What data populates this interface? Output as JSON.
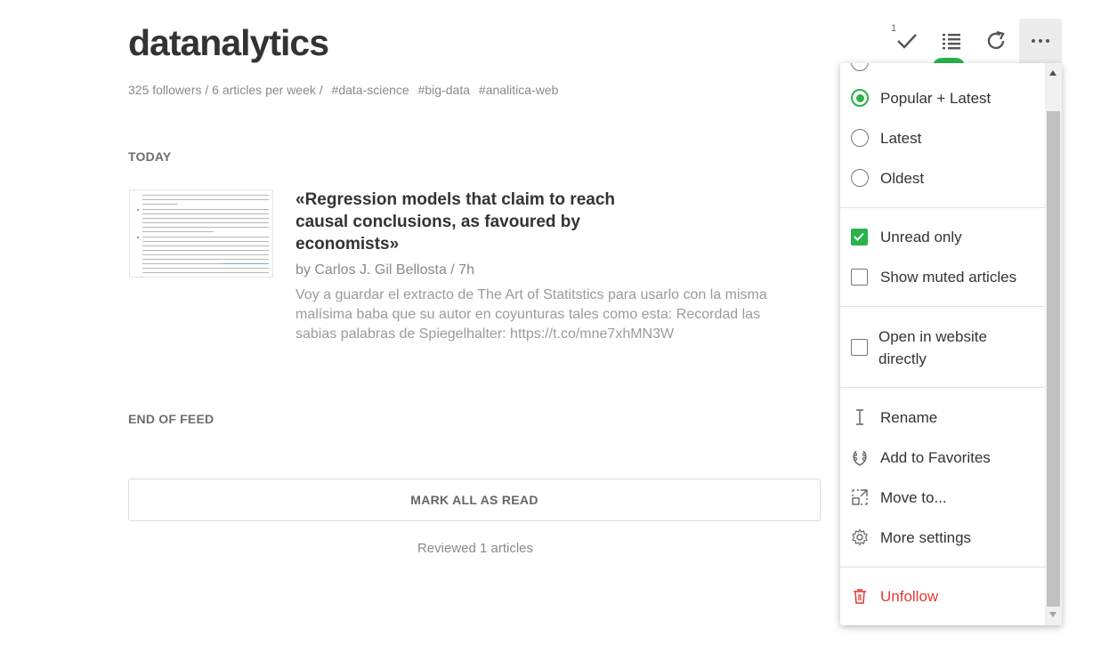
{
  "feed": {
    "title": "datanalytics",
    "stats": "325 followers / 6 articles per week /",
    "tags": [
      "#data-science",
      "#big-data",
      "#analitica-web"
    ]
  },
  "sections": {
    "today": "TODAY",
    "end": "END OF FEED"
  },
  "article": {
    "title": "«Regression models that claim to reach causal conclusions, as favoured by economists»",
    "byline": "by Carlos J. Gil Bellosta / 7h",
    "summary": "Voy a guardar el extracto de The Art of Statitstics para usarlo con la misma malísima baba que su autor en coyunturas tales como esta: Recordad las sabias palabras de Spiegelhalter: https://t.co/mne7xhMN3W"
  },
  "actions": {
    "mark_all": "MARK ALL AS READ",
    "reviewed": "Reviewed 1 articles"
  },
  "toolbar": {
    "mark_read_badge": "1",
    "icons": [
      "checkmark-icon",
      "list-view-icon",
      "refresh-icon",
      "more-options-icon"
    ]
  },
  "menu": {
    "sort_options": [
      {
        "label": "Popular + Latest",
        "selected": true
      },
      {
        "label": "Latest",
        "selected": false
      },
      {
        "label": "Oldest",
        "selected": false
      }
    ],
    "filters": [
      {
        "label": "Unread only",
        "checked": true
      },
      {
        "label": "Show muted articles",
        "checked": false
      }
    ],
    "open_in_website": {
      "label": "Open in website directly",
      "checked": false
    },
    "actions": [
      {
        "label": "Rename",
        "icon": "text-cursor-icon"
      },
      {
        "label": "Add to Favorites",
        "icon": "laurel-icon"
      },
      {
        "label": "Move to...",
        "icon": "move-icon"
      },
      {
        "label": "More settings",
        "icon": "gear-icon"
      }
    ],
    "unfollow": {
      "label": "Unfollow",
      "icon": "trash-icon"
    }
  },
  "colors": {
    "accent": "#2bb24c",
    "danger": "#e53935",
    "text": "#333333",
    "muted": "#8a8a8a"
  }
}
